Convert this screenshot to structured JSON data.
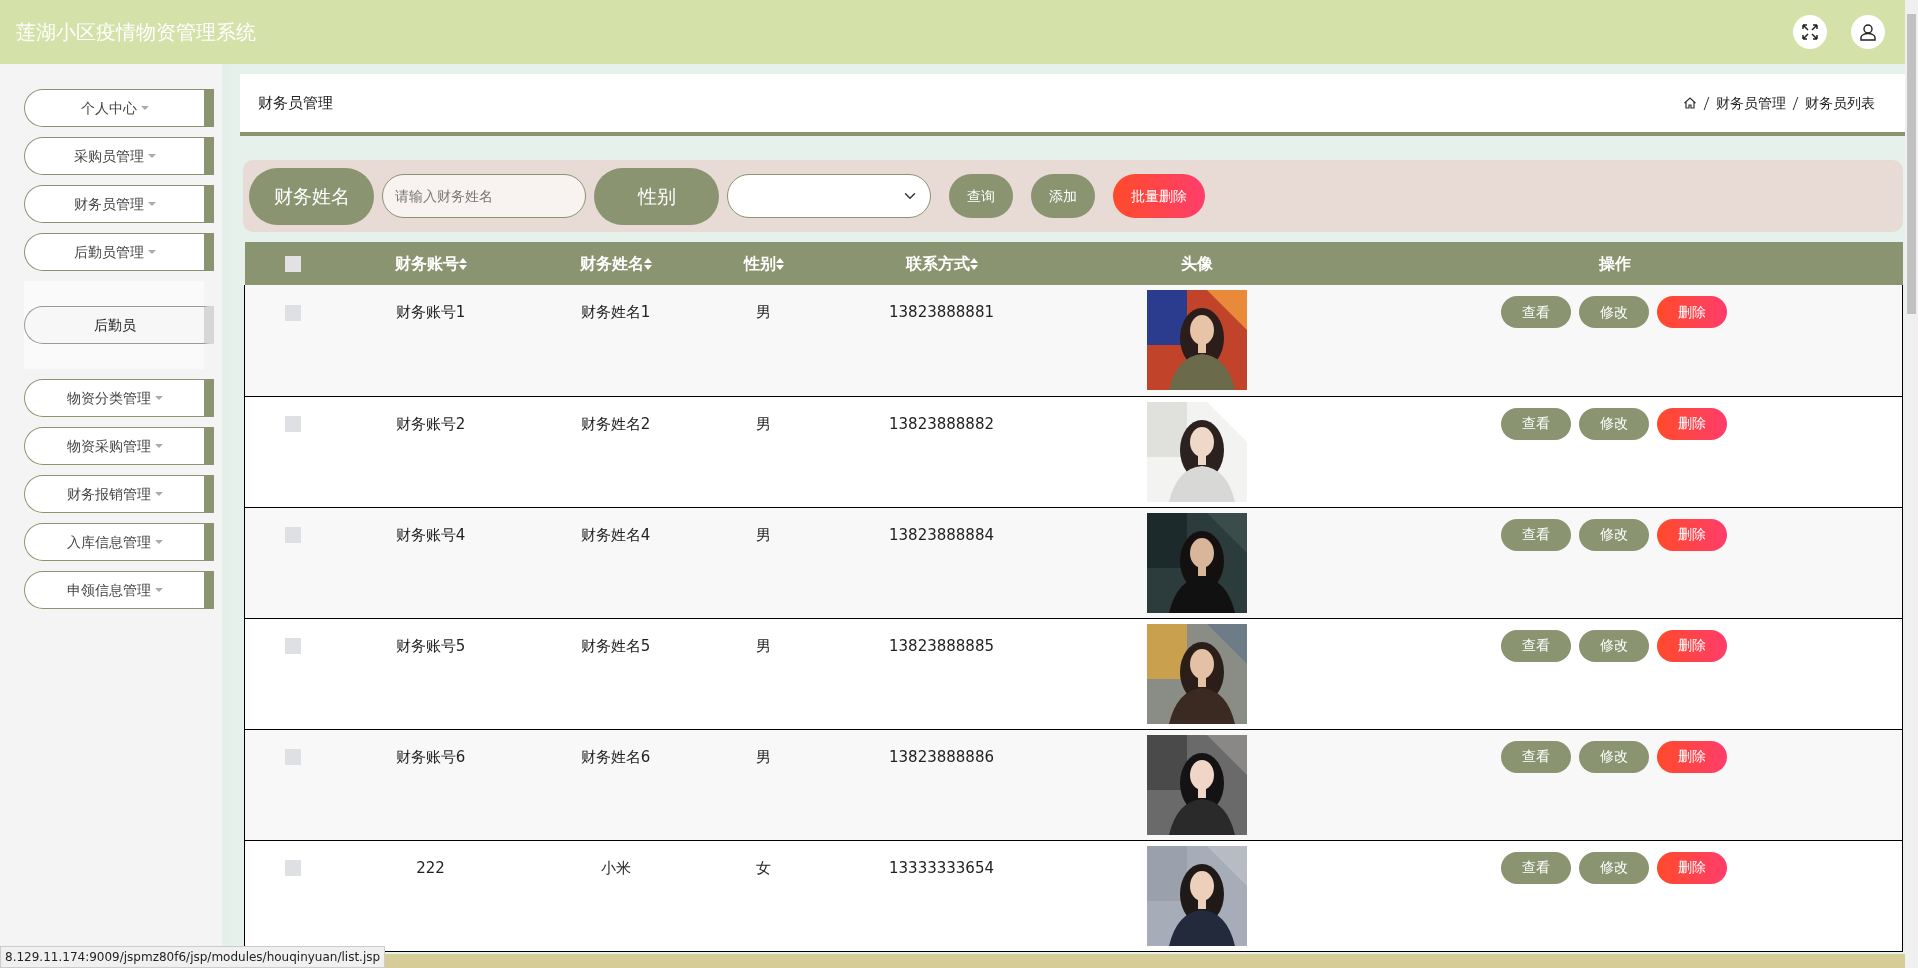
{
  "header": {
    "title": "莲湖小区疫情物资管理系统"
  },
  "sidebar": {
    "items": [
      {
        "label": "个人中心"
      },
      {
        "label": "采购员管理"
      },
      {
        "label": "财务员管理"
      },
      {
        "label": "后勤员管理",
        "children": [
          {
            "label": "后勤员"
          }
        ]
      },
      {
        "label": "物资分类管理"
      },
      {
        "label": "物资采购管理"
      },
      {
        "label": "财务报销管理"
      },
      {
        "label": "入库信息管理"
      },
      {
        "label": "申领信息管理"
      }
    ]
  },
  "breadcrumb": {
    "title": "财务员管理",
    "trail": [
      "财务员管理",
      "财务员列表"
    ]
  },
  "search": {
    "fields": [
      {
        "kind": "text",
        "label": "财务姓名",
        "placeholder": "请输入财务姓名"
      },
      {
        "kind": "select",
        "label": "性别"
      }
    ],
    "buttons": [
      {
        "label": "查询",
        "kind": "primary"
      },
      {
        "label": "添加",
        "kind": "primary"
      },
      {
        "label": "批量删除",
        "kind": "danger"
      }
    ]
  },
  "table": {
    "select_all_checked": false,
    "columns": [
      {
        "label": "财务账号",
        "sortable": true
      },
      {
        "label": "财务姓名",
        "sortable": true
      },
      {
        "label": "性别",
        "sortable": true
      },
      {
        "label": "联系方式",
        "sortable": true
      },
      {
        "label": "头像",
        "sortable": false
      },
      {
        "label": "操作",
        "sortable": false
      }
    ],
    "rows": [
      {
        "checked": false,
        "cells": [
          "财务账号1",
          "财务姓名1",
          "男",
          "13823888881"
        ],
        "actions": [
          {
            "label": "查看",
            "kind": "primary"
          },
          {
            "label": "修改",
            "kind": "primary"
          },
          {
            "label": "删除",
            "kind": "danger"
          }
        ]
      },
      {
        "checked": false,
        "cells": [
          "财务账号2",
          "财务姓名2",
          "男",
          "13823888882"
        ],
        "actions": [
          {
            "label": "查看",
            "kind": "primary"
          },
          {
            "label": "修改",
            "kind": "primary"
          },
          {
            "label": "删除",
            "kind": "danger"
          }
        ]
      },
      {
        "checked": false,
        "cells": [
          "财务账号4",
          "财务姓名4",
          "男",
          "13823888884"
        ],
        "actions": [
          {
            "label": "查看",
            "kind": "primary"
          },
          {
            "label": "修改",
            "kind": "primary"
          },
          {
            "label": "删除",
            "kind": "danger"
          }
        ]
      },
      {
        "checked": false,
        "cells": [
          "财务账号5",
          "财务姓名5",
          "男",
          "13823888885"
        ],
        "actions": [
          {
            "label": "查看",
            "kind": "primary"
          },
          {
            "label": "修改",
            "kind": "primary"
          },
          {
            "label": "删除",
            "kind": "danger"
          }
        ]
      },
      {
        "checked": false,
        "cells": [
          "财务账号6",
          "财务姓名6",
          "男",
          "13823888886"
        ],
        "actions": [
          {
            "label": "查看",
            "kind": "primary"
          },
          {
            "label": "修改",
            "kind": "primary"
          },
          {
            "label": "删除",
            "kind": "danger"
          }
        ]
      },
      {
        "checked": false,
        "cells": [
          "222",
          "小米",
          "女",
          "13333333654"
        ],
        "actions": [
          {
            "label": "查看",
            "kind": "primary"
          },
          {
            "label": "修改",
            "kind": "primary"
          },
          {
            "label": "删除",
            "kind": "danger"
          }
        ]
      }
    ]
  },
  "status_bar": {
    "url": "8.129.11.174:9009/jspmz80f6/jsp/modules/houqinyuan/list.jsp"
  }
}
